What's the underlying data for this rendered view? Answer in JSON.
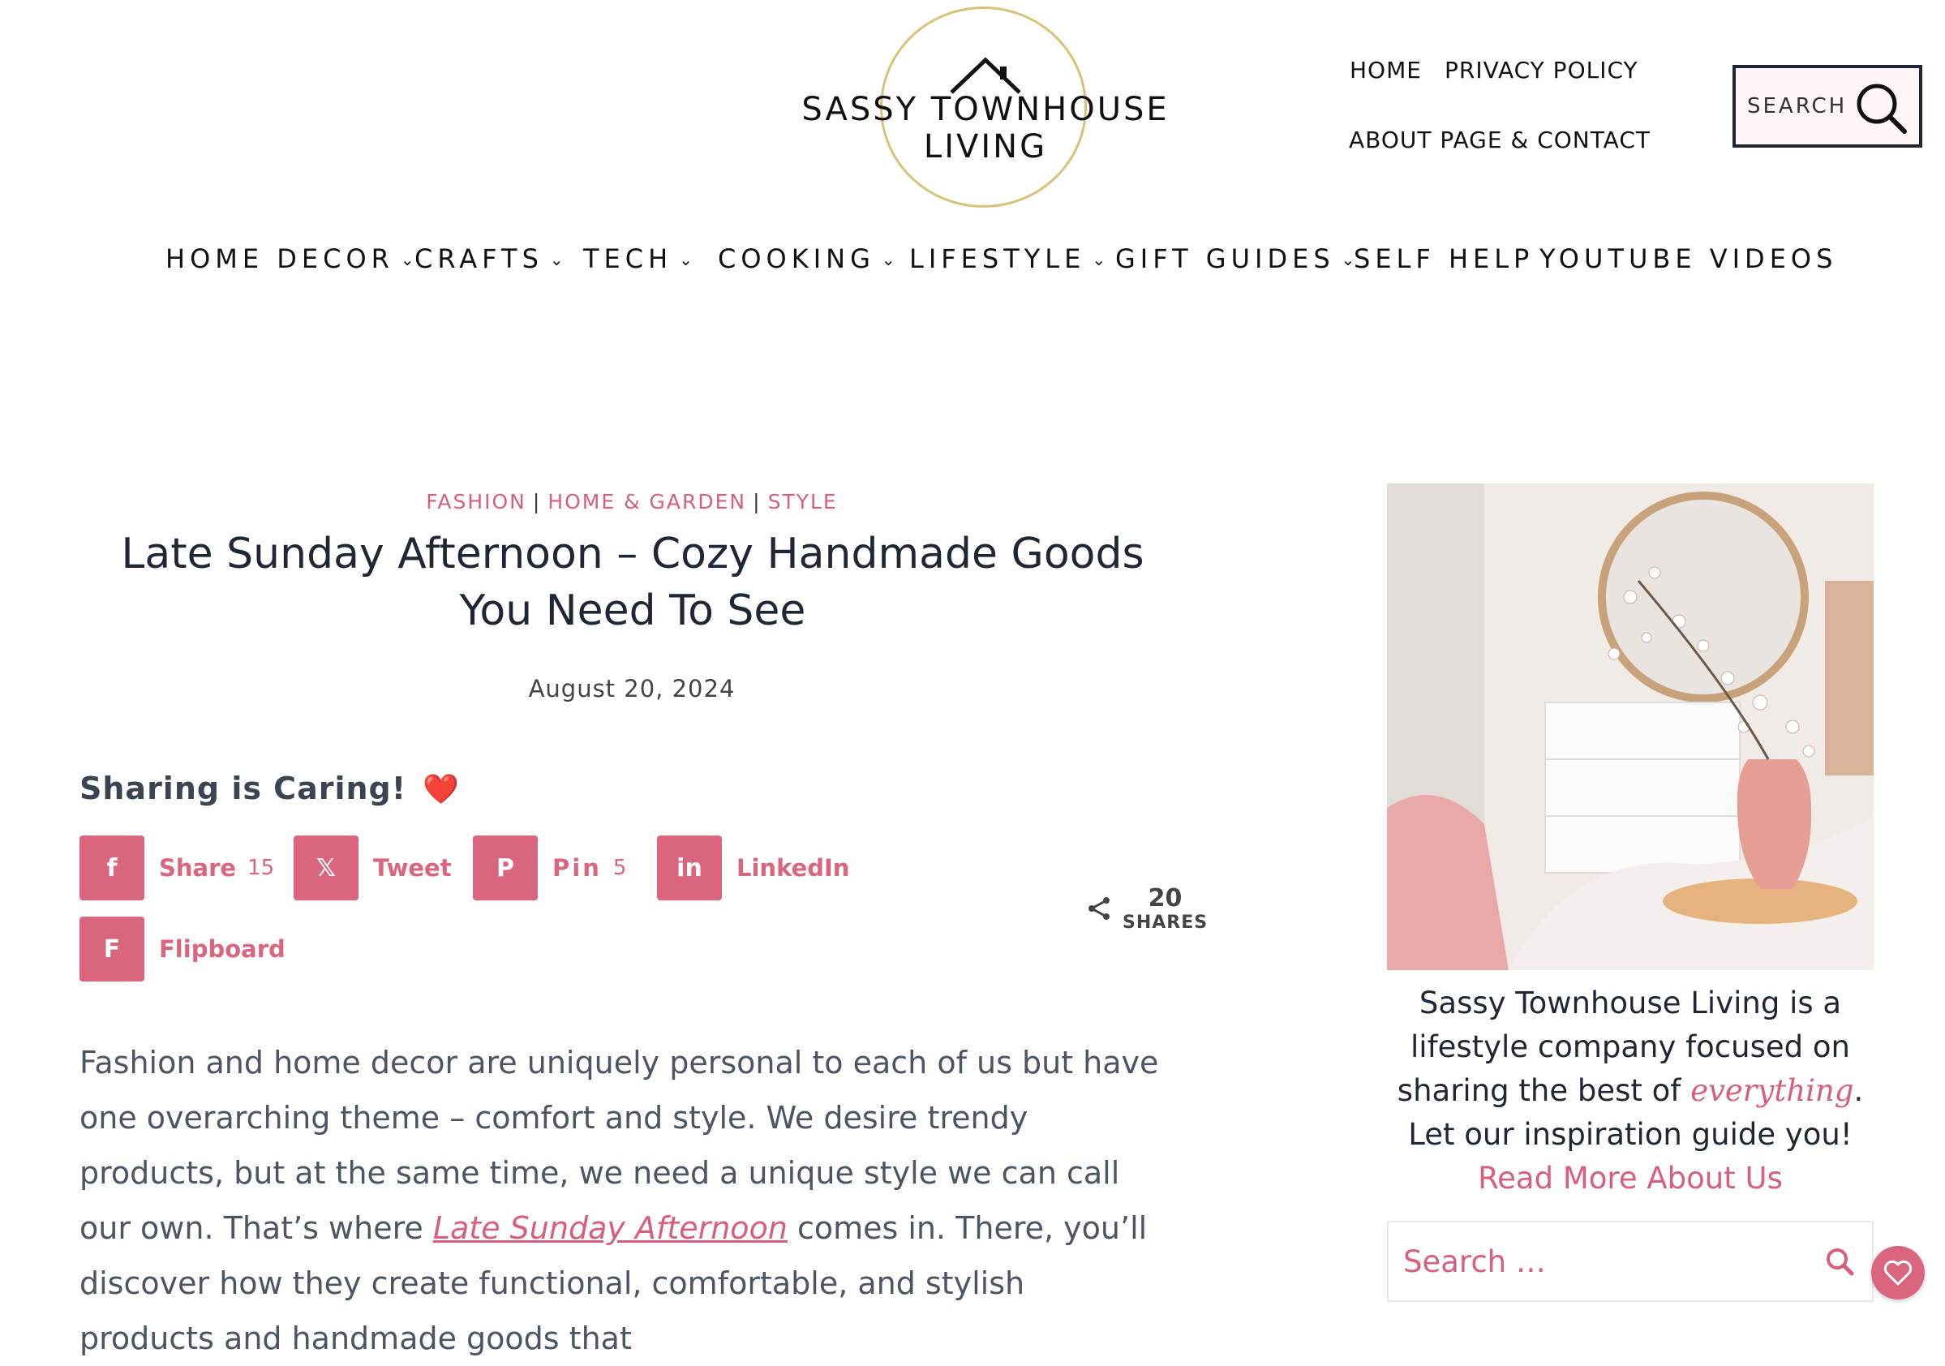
{
  "header": {
    "logo_text": "SASSY TOWNHOUSE LIVING",
    "top_links": {
      "home": "HOME",
      "privacy": "PRIVACY POLICY",
      "about": "ABOUT PAGE & CONTACT"
    },
    "search_label": "SEARCH",
    "search_icon": "magnifier-icon"
  },
  "nav": {
    "items": [
      {
        "label": "HOME DECOR",
        "has_dropdown": true
      },
      {
        "label": "CRAFTS",
        "has_dropdown": true
      },
      {
        "label": "TECH",
        "has_dropdown": true
      },
      {
        "label": "COOKING",
        "has_dropdown": true
      },
      {
        "label": "LIFESTYLE",
        "has_dropdown": true
      },
      {
        "label": "GIFT GUIDES",
        "has_dropdown": true
      },
      {
        "label": "SELF HELP",
        "has_dropdown": false
      },
      {
        "label": "YOUTUBE VIDEOS",
        "has_dropdown": false
      }
    ],
    "chevron": "⌄"
  },
  "article": {
    "categories": [
      "FASHION",
      "HOME & GARDEN",
      "STYLE"
    ],
    "category_separator": "|",
    "title": "Late Sunday Afternoon – Cozy Handmade Goods You Need To See",
    "date": "August 20, 2024",
    "sharing_heading": "Sharing is Caring!",
    "sharing_emoji": "❤️",
    "share_buttons": [
      {
        "label": "Share",
        "count": "15",
        "icon": "facebook-icon",
        "glyph": "f"
      },
      {
        "label": "Tweet",
        "count": "",
        "icon": "x-icon",
        "glyph": "𝕏"
      },
      {
        "label": "Pin",
        "count": "5",
        "icon": "pinterest-icon",
        "glyph": "P"
      },
      {
        "label": "LinkedIn",
        "count": "",
        "icon": "linkedin-icon",
        "glyph": "in"
      },
      {
        "label": "Flipboard",
        "count": "",
        "icon": "flipboard-icon",
        "glyph": "F"
      }
    ],
    "total_shares": {
      "count": "20",
      "label": "SHARES",
      "icon": "share-icon"
    },
    "body": {
      "text_1": "Fashion and home decor are uniquely personal to each of us but have one overarching theme – comfort and style. We desire trendy products, but at the same time, we need a unique style we can call our own. That’s where ",
      "link": "Late Sunday Afternoon",
      "text_2": " comes in. There, you’ll discover how they create functional, comfortable, and stylish products and handmade goods that"
    }
  },
  "sidebar": {
    "about_1": "Sassy Townhouse Living is a lifestyle company focused on sharing the best of ",
    "about_script": "everything",
    "about_2": ". Let our inspiration guide you!",
    "read_more": "Read More About Us",
    "search_placeholder": "Search …",
    "search_icon": "magnifier-icon"
  },
  "colors": {
    "accent": "#d9657f",
    "accent_text": "#d65f7e",
    "dark": "#1e2733",
    "search_bg": "#fff5f4",
    "logo_gold": "#d8c27a"
  },
  "floating_button_icon": "heart-icon"
}
